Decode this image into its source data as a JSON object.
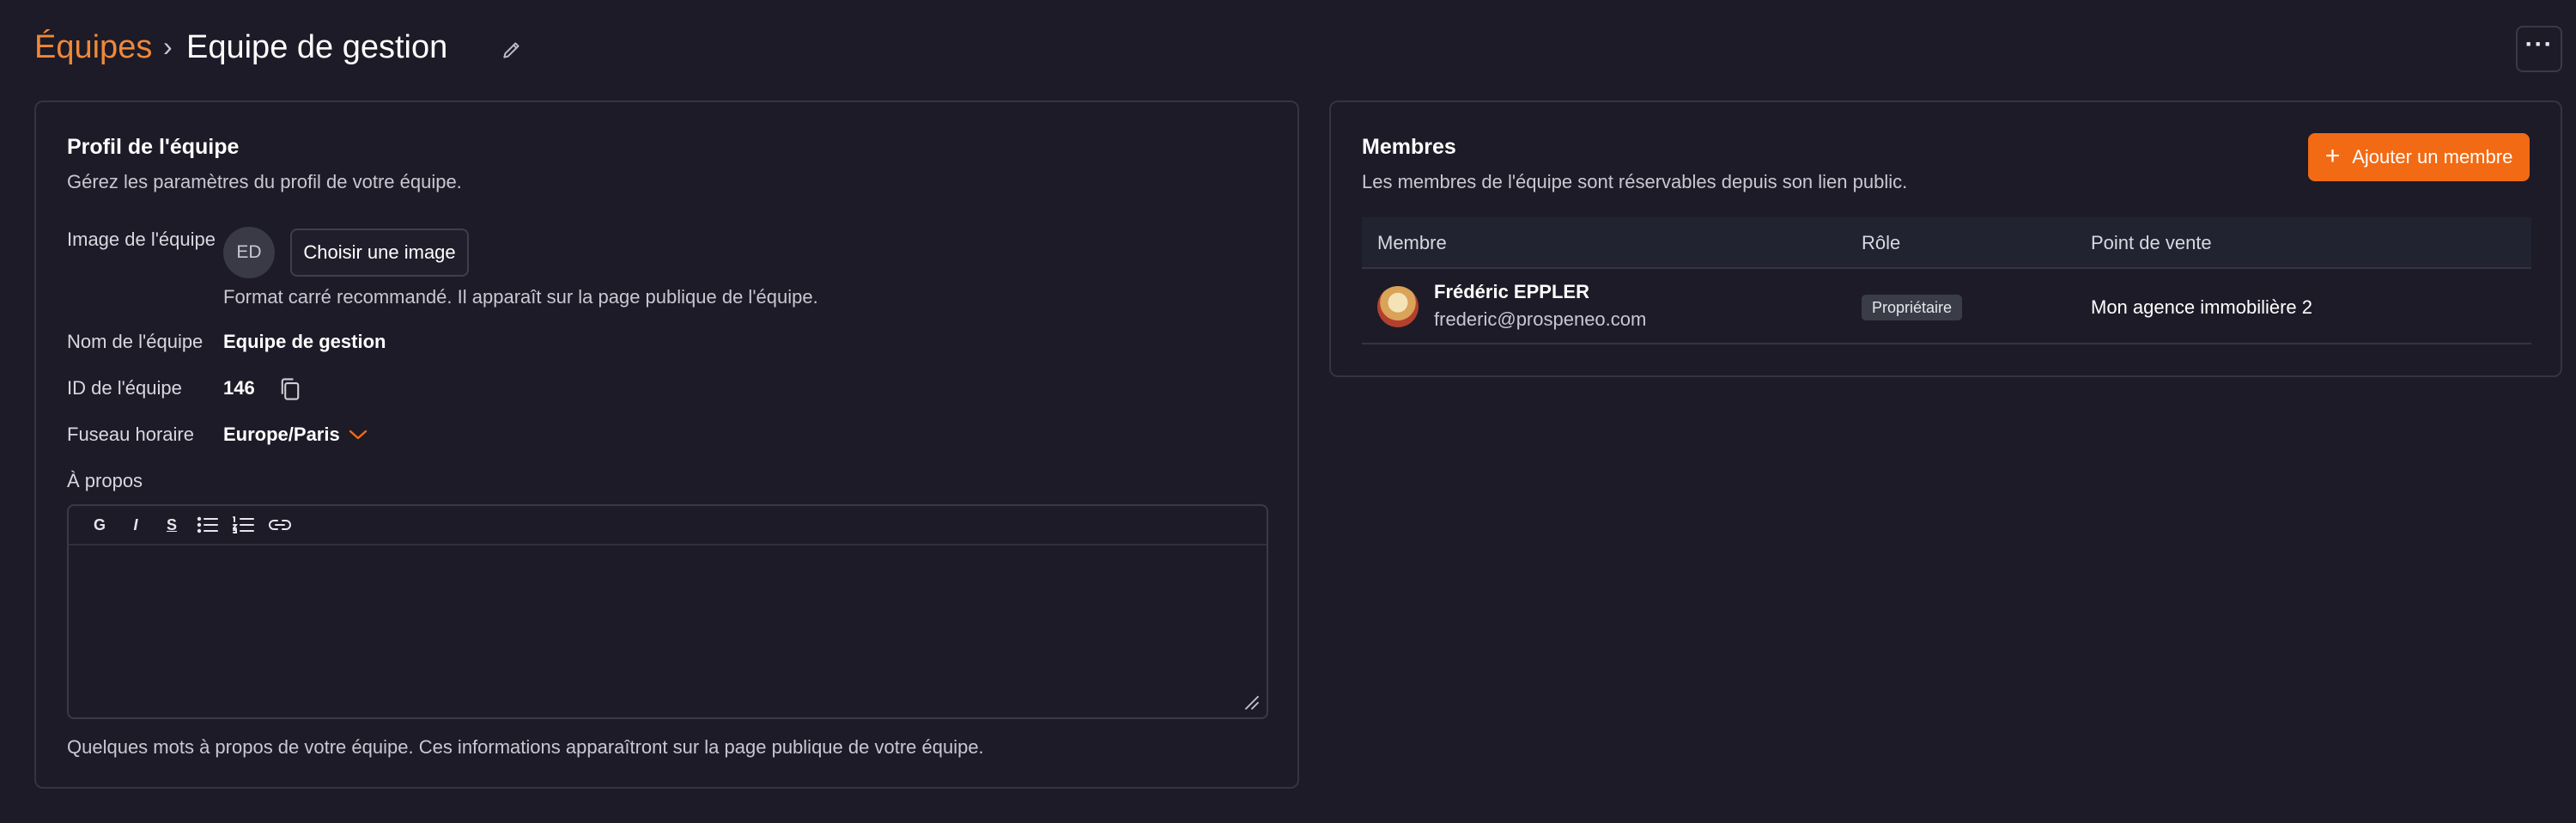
{
  "header": {
    "breadcrumb_link": "Équipes",
    "breadcrumb_separator": "›",
    "title": "Equipe de gestion",
    "more_label": "···"
  },
  "profile": {
    "title": "Profil de l'équipe",
    "subtitle": "Gérez les paramètres du profil de votre équipe.",
    "image_label": "Image de l'équipe",
    "avatar_initials": "ED",
    "choose_image_label": "Choisir une image",
    "image_hint": "Format carré recommandé. Il apparaît sur la page publique de l'équipe.",
    "name_label": "Nom de l'équipe",
    "name_value": "Equipe de gestion",
    "id_label": "ID de l'équipe",
    "id_value": "146",
    "timezone_label": "Fuseau horaire",
    "timezone_value": "Europe/Paris",
    "about_label": "À propos",
    "about_value": "",
    "about_hint": "Quelques mots à propos de votre équipe. Ces informations apparaîtront sur la page publique de votre équipe.",
    "toolbar": {
      "bold": "G",
      "italic": "I",
      "underline": "S"
    }
  },
  "members": {
    "title": "Membres",
    "subtitle": "Les membres de l'équipe sont réservables depuis son lien public.",
    "add_label": "Ajouter un membre",
    "columns": [
      "Membre",
      "Rôle",
      "Point de vente"
    ],
    "rows": [
      {
        "name": "Frédéric EPPLER",
        "email": "frederic@prospeneo.com",
        "role": "Propriétaire",
        "point_of_sale": "Mon agence immobilière 2"
      }
    ]
  },
  "colors": {
    "accent": "#f26a13",
    "breadcrumb": "#f0883a",
    "background": "#1c1b27"
  }
}
